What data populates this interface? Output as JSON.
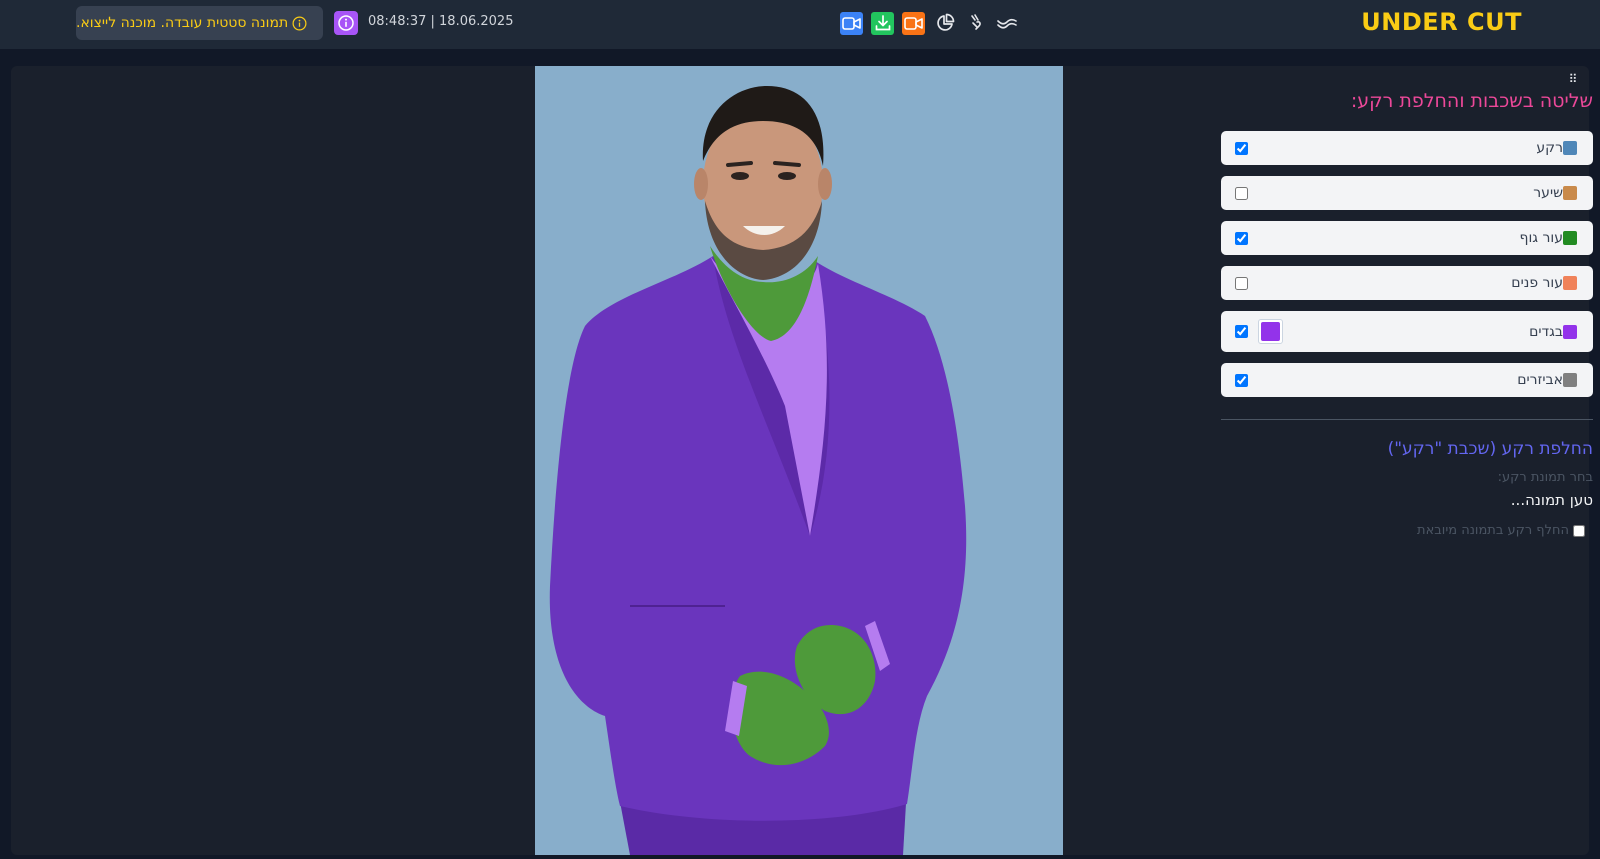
{
  "header": {
    "status_text": "תמונה סטטית עובדה. מוכנה לייצוא.",
    "datetime": "08:48:37 | 18.06.2025",
    "brand": "UNDER CUT",
    "toolbar_icons": [
      "video-camera-icon",
      "download-icon",
      "video-record-icon",
      "pie-chart-icon",
      "hand-wave-icon",
      "wave-icon"
    ]
  },
  "sidebar": {
    "title": "שליטה בשכבות והחלפת רקע:",
    "layers": [
      {
        "label": "רקע",
        "color": "#4f87b8",
        "checked": true
      },
      {
        "label": "שיער",
        "color": "#c98a4b",
        "checked": false
      },
      {
        "label": "עור גוף",
        "color": "#228b22",
        "checked": true
      },
      {
        "label": "עור פנים",
        "color": "#f0825a",
        "checked": false
      },
      {
        "label": "בגדים",
        "color": "#9333ea",
        "checked": true,
        "picker_color": "#9333ea"
      },
      {
        "label": "אביזרים",
        "color": "#808080",
        "checked": true
      }
    ],
    "bg_section": {
      "title": "החלפת רקע (שכבת \"רקע\")",
      "choose_label": "בחר תמונת רקע:",
      "loading_text": "טען תמונה...",
      "replace_label": "החלף רקע בתמונה מיובאת",
      "replace_checked": false
    }
  },
  "colors": {
    "brand": "#facc15",
    "title_pink": "#ec4899",
    "title_indigo": "#6366f1",
    "photo_bg": "#88aecb",
    "suit": "#6030b0",
    "shirt": "#b57cf0",
    "skin_green": "#4e9a3a"
  }
}
